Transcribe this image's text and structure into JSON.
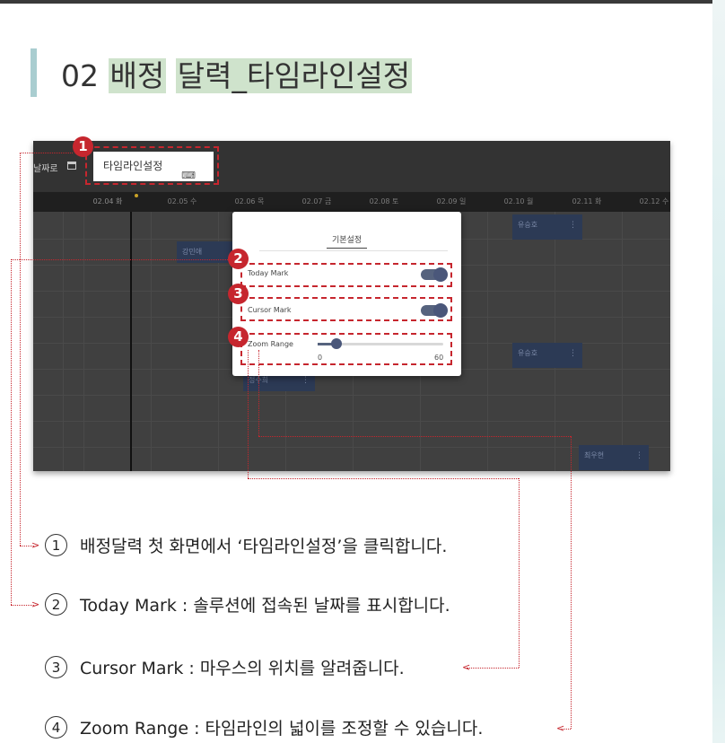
{
  "heading": {
    "number": "02",
    "word1": "배정",
    "word2": "달력_타임라인설정"
  },
  "toolbar": {
    "date_picker_label": "날짜로",
    "timeline_button_label": "타임라인설정",
    "keyboard_icon": "⌨"
  },
  "date_header": [
    "02.04 화",
    "02.05 수",
    "02.06 목",
    "02.07 금",
    "02.08 토",
    "02.09 일",
    "02.10 월",
    "02.11 화",
    "02.12 수"
  ],
  "events": [
    {
      "label": "유승호"
    },
    {
      "label": "강민애"
    },
    {
      "label": "유승호"
    },
    {
      "label": "정수희"
    },
    {
      "label": "최우현"
    }
  ],
  "dialog": {
    "title": "기본설정",
    "today_mark_label": "Today Mark",
    "cursor_mark_label": "Cursor Mark",
    "zoom_range_label": "Zoom Range",
    "zoom_min": "0",
    "zoom_max": "60",
    "zoom_value": 5
  },
  "badges": [
    "1",
    "2",
    "3",
    "4"
  ],
  "descriptions": [
    {
      "num": "①",
      "text": "배정달력 첫 화면에서 ‘타임라인설정’을 클릭합니다."
    },
    {
      "num": "②",
      "text": "Today Mark : 솔루션에 접속된 날짜를 표시합니다."
    },
    {
      "num": "③",
      "text": "Cursor Mark : 마우스의 위치를 알려줍니다."
    },
    {
      "num": "④",
      "text": "Zoom Range : 타임라인의 넓이를 조정할 수 있습니다."
    }
  ],
  "colors": {
    "accent": "#c6262e",
    "highlight": "#cfe3cc",
    "event": "#2c3a55"
  }
}
